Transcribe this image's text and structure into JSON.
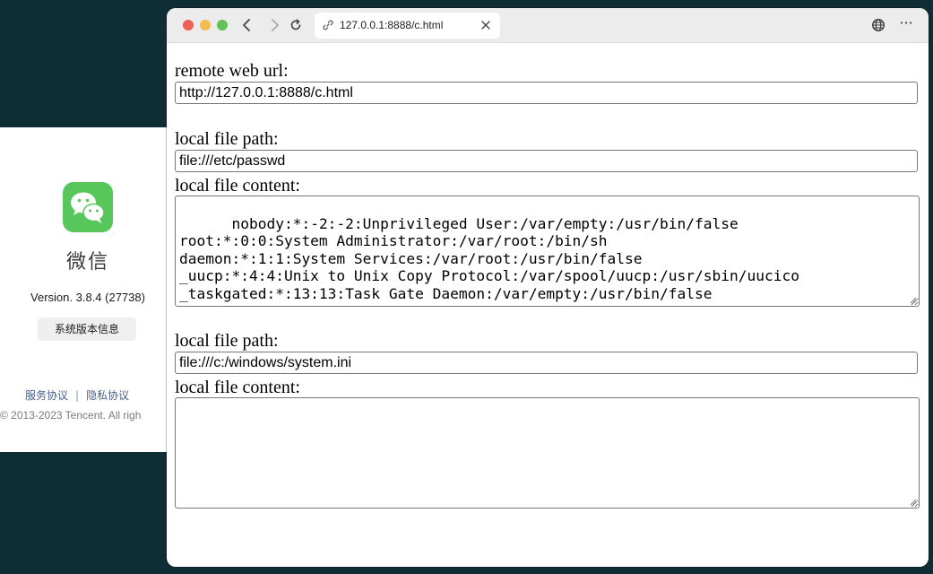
{
  "about_window": {
    "app_name": "微信",
    "version": "Version. 3.8.4 (27738)",
    "system_info_button": "系统版本信息",
    "terms_link": "服务协议",
    "link_separator": "|",
    "privacy_link": "隐私协议",
    "copyright": "© 2013-2023 Tencent. All righ",
    "logo_color": "#58c75b"
  },
  "browser": {
    "tab_url": "127.0.0.1:8888/c.html",
    "more_label": "···"
  },
  "page": {
    "remote_label": "remote web url:",
    "remote_value": "http://127.0.0.1:8888/c.html",
    "section1": {
      "path_label": "local file path:",
      "path_value": "file:///etc/passwd",
      "content_label": "local file content:",
      "content_value": "nobody:*:-2:-2:Unprivileged User:/var/empty:/usr/bin/false\nroot:*:0:0:System Administrator:/var/root:/bin/sh\ndaemon:*:1:1:System Services:/var/root:/usr/bin/false\n_uucp:*:4:4:Unix to Unix Copy Protocol:/var/spool/uucp:/usr/sbin/uucico\n_taskgated:*:13:13:Task Gate Daemon:/var/empty:/usr/bin/false\n_networkd:*:24:24:Network Services:/var/networkd:/usr/bin/false\n_installassistant:*:25:25:Install Assistant:/var/empty:/usr/bin/false"
    },
    "section2": {
      "path_label": "local file path:",
      "path_value": "file:///c:/windows/system.ini",
      "content_label": "local file content:",
      "content_value": ""
    }
  }
}
